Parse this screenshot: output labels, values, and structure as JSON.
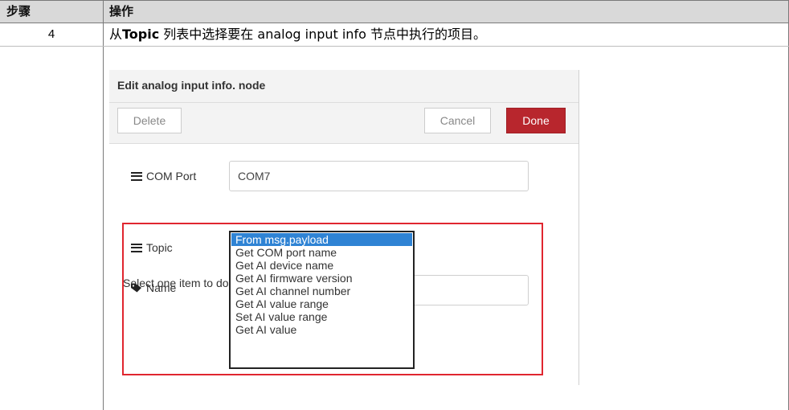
{
  "table": {
    "headers": [
      "步骤",
      "操作"
    ],
    "step_number": "4",
    "instruction": {
      "prefix": "从",
      "bold": "Topic",
      "suffix": " 列表中选择要在 analog input info 节点中执行的项目。"
    }
  },
  "dialog": {
    "title": "Edit analog input info. node",
    "buttons": {
      "delete": "Delete",
      "cancel": "Cancel",
      "done": "Done"
    },
    "com_port": {
      "label": "COM Port",
      "value": "COM7"
    },
    "hint": "Select one item to do the specified action.",
    "topic": {
      "label": "Topic",
      "options": [
        "From msg.payload",
        "Get COM port name",
        "Get AI device name",
        "Get AI firmware version",
        "Get AI channel number",
        "Get AI value range",
        "Set AI value range",
        "Get AI value"
      ],
      "selected": "From msg.payload"
    },
    "name": {
      "label": "Name",
      "value": ""
    }
  },
  "colors": {
    "done_button": "#b8262d",
    "highlight_border": "#e0262f",
    "selected_option": "#2f83d4",
    "header_background": "#d9d9d9"
  }
}
